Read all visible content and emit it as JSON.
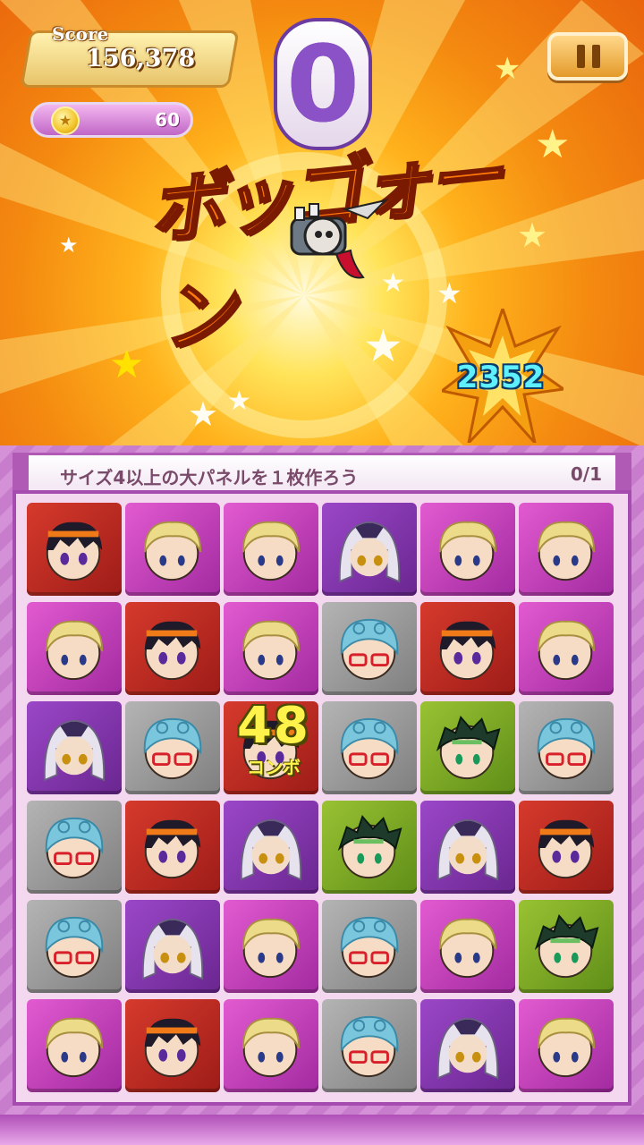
{
  "hud": {
    "score_label": "Score",
    "score_value": "156,378",
    "coin_value": "60",
    "counter_value": "0",
    "pause_icon": "pause-icon"
  },
  "battle": {
    "sfx_text": "ボッゴォーン",
    "damage_value": "2352"
  },
  "mission": {
    "text": "サイズ4以上の大パネルを１枚作ろう",
    "progress": "0/1"
  },
  "combo": {
    "count": "48",
    "label": "コンボ"
  },
  "board": {
    "rows": [
      [
        "red-orange-hair",
        "pink-blonde",
        "pink-blonde",
        "purple-silver",
        "pink-blonde",
        "pink-blonde"
      ],
      [
        "pink-blonde",
        "red-orange-hair",
        "pink-blonde",
        "gray-blue-curls",
        "red-orange-hair",
        "pink-blonde"
      ],
      [
        "purple-silver",
        "gray-blue-curls",
        "red-orange-hair",
        "gray-blue-curls",
        "green-dark",
        "gray-blue-curls"
      ],
      [
        "gray-blue-curls",
        "red-orange-hair",
        "purple-silver",
        "green-dark",
        "purple-silver",
        "red-orange-hair"
      ],
      [
        "gray-blue-curls",
        "purple-silver",
        "pink-blonde",
        "gray-blue-curls",
        "pink-blonde",
        "green-dark"
      ],
      [
        "pink-blonde",
        "red-orange-hair",
        "pink-blonde",
        "gray-blue-curls",
        "purple-silver",
        "pink-blonde"
      ]
    ]
  },
  "colors": {
    "red": "#c22d23",
    "pink": "#c842bc",
    "purple": "#8438b0",
    "gray": "#9a9a9a",
    "green": "#7cab26",
    "accent": "#a64bb0"
  }
}
